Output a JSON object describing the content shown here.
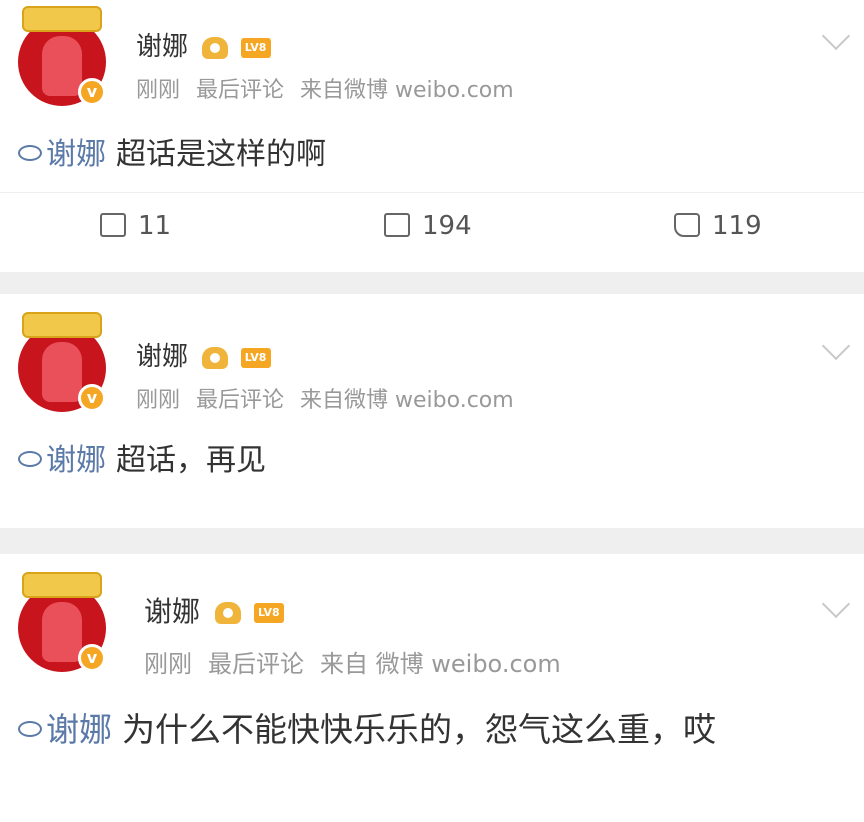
{
  "posts": [
    {
      "username": "谢娜",
      "level_badge": "LV8",
      "time": "刚刚",
      "sort_label": "最后评论",
      "source": "来自微博 weibo.com",
      "topic": "谢娜",
      "text": "超话是这样的啊",
      "actions": {
        "forward": "11",
        "comment": "194",
        "like": "119"
      }
    },
    {
      "username": "谢娜",
      "level_badge": "LV8",
      "time": "刚刚",
      "sort_label": "最后评论",
      "source": "来自微博 weibo.com",
      "topic": "谢娜",
      "text": "超话，再见"
    },
    {
      "username": "谢娜",
      "level_badge": "LV8",
      "time": "刚刚",
      "sort_label": "最后评论",
      "source": "来自 微博 weibo.com",
      "topic": "谢娜",
      "text": "为什么不能快快乐乐的，怨气这么重，哎"
    }
  ],
  "icons": {
    "avatar_badge": "verified-v-icon",
    "topic": "supertopic-diamond-icon",
    "forward": "forward-icon",
    "comment": "comment-icon",
    "like": "thumbs-up-icon",
    "menu": "chevron-down-icon"
  },
  "colors": {
    "topic_link": "#5b7aa8",
    "verified_badge": "#f5a623",
    "separator": "#efefef"
  }
}
